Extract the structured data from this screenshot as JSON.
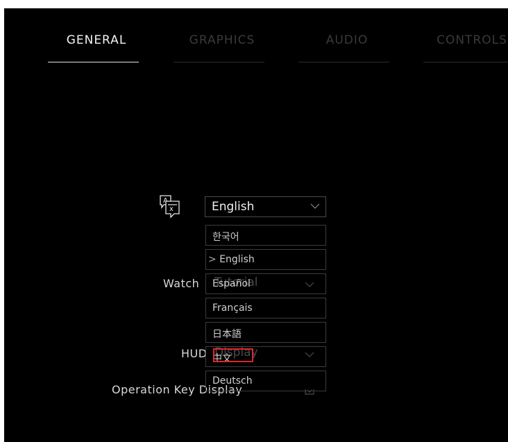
{
  "tabs": [
    {
      "label": "GENERAL",
      "active": true
    },
    {
      "label": "GRAPHICS",
      "active": false
    },
    {
      "label": "AUDIO",
      "active": false
    },
    {
      "label": "CONTROLS",
      "active": false
    }
  ],
  "language": {
    "icon": "translate-icon",
    "selected": "English",
    "chevron_icon": "chevron-down-icon",
    "options": [
      {
        "label": "한국어"
      },
      {
        "label": "English",
        "marker": ">"
      },
      {
        "label": "Español"
      },
      {
        "label": "Français"
      },
      {
        "label": "日本語"
      },
      {
        "label": "中文"
      },
      {
        "label": "Deutsch"
      }
    ]
  },
  "settings_rows": {
    "watch": {
      "label": "Watch",
      "value": "Tutorial"
    },
    "hud": {
      "label": "HUD",
      "value": "Display"
    },
    "operation": {
      "label": "Operation Key Display"
    }
  },
  "colors": {
    "background": "#000000",
    "highlight": "#e0252a"
  }
}
